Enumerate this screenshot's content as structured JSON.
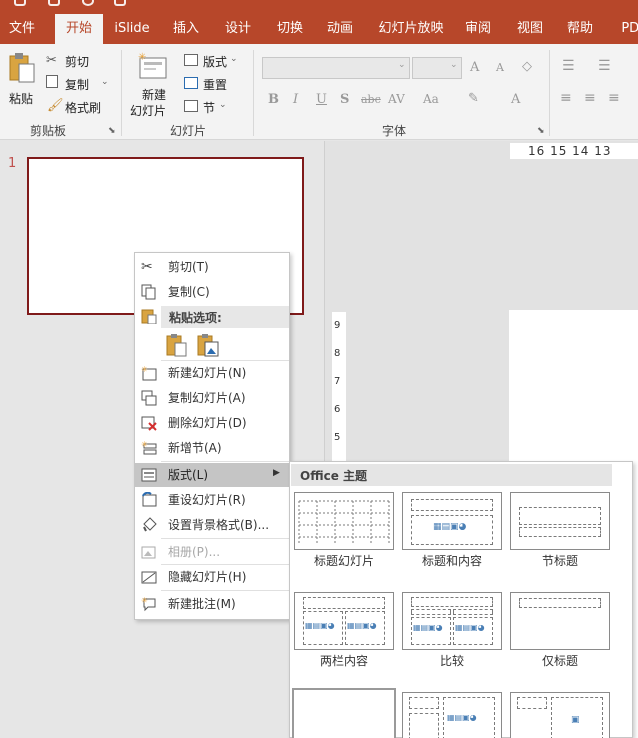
{
  "ribbon_tabs": [
    "文件",
    "开始",
    "iSlide",
    "插入",
    "设计",
    "切换",
    "动画",
    "幻灯片放映",
    "审阅",
    "视图",
    "帮助",
    "PDF"
  ],
  "active_tab": "开始",
  "clipboard_group": {
    "paste": "粘贴",
    "cut": "剪切",
    "copy": "复制",
    "format_painter": "格式刷",
    "label": "剪贴板"
  },
  "slides_group": {
    "new_slide_line1": "新建",
    "new_slide_line2": "幻灯片",
    "layout": "版式",
    "reset": "重置",
    "section": "节",
    "label": "幻灯片"
  },
  "font_group": {
    "label": "字体",
    "bold": "B",
    "italic": "I",
    "underline": "U",
    "shadow": "S",
    "strike": "abc",
    "spacing": "AV",
    "case": "Aa",
    "grow": "A",
    "shrink": "A",
    "color": "A"
  },
  "slide_number": "1",
  "horizontal_ruler": "16 15 14 13",
  "vertical_ruler": [
    "9",
    "8",
    "7",
    "6",
    "5"
  ],
  "context_menu": {
    "cut": "剪切(T)",
    "copy": "复制(C)",
    "paste_options": "粘贴选项:",
    "new_slide": "新建幻灯片(N)",
    "duplicate_slide": "复制幻灯片(A)",
    "delete_slide": "删除幻灯片(D)",
    "add_section": "新增节(A)",
    "layout": "版式(L)",
    "reset_slide": "重设幻灯片(R)",
    "format_background": "设置背景格式(B)...",
    "photo_album": "相册(P)...",
    "hide_slide": "隐藏幻灯片(H)",
    "new_comment": "新建批注(M)"
  },
  "layout_submenu": {
    "theme": "Office 主题",
    "layouts": [
      "标题幻灯片",
      "标题和内容",
      "节标题",
      "两栏内容",
      "比较",
      "仅标题"
    ]
  },
  "colors": {
    "accent": "#b7472a",
    "thumbnail_border": "#7f1a1a",
    "highlight": "#c5c5c5"
  }
}
